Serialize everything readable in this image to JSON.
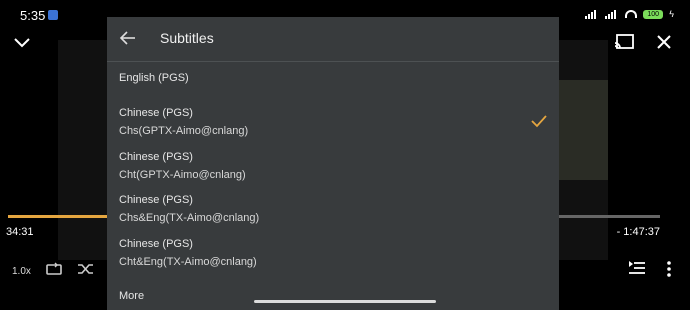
{
  "status_bar": {
    "time": "5:35",
    "battery": "100"
  },
  "player": {
    "elapsed": "34:31",
    "remaining": "- 1:47:37",
    "speed": "1.0x",
    "progress_fraction": 0.24,
    "accent_color": "#e5a640"
  },
  "subtitles_panel": {
    "title": "Subtitles",
    "options": [
      {
        "lang": "English (PGS)",
        "track": ""
      },
      {
        "lang": "Chinese (PGS)",
        "track": "Chs(GPTX-Aimo@cnlang)",
        "selected": true
      },
      {
        "lang": "Chinese (PGS)",
        "track": "Cht(GPTX-Aimo@cnlang)"
      },
      {
        "lang": "Chinese (PGS)",
        "track": "Chs&Eng(TX-Aimo@cnlang)"
      },
      {
        "lang": "Chinese (PGS)",
        "track": "Cht&Eng(TX-Aimo@cnlang)"
      }
    ],
    "more_label": "More",
    "check_color": "#e5a640"
  }
}
